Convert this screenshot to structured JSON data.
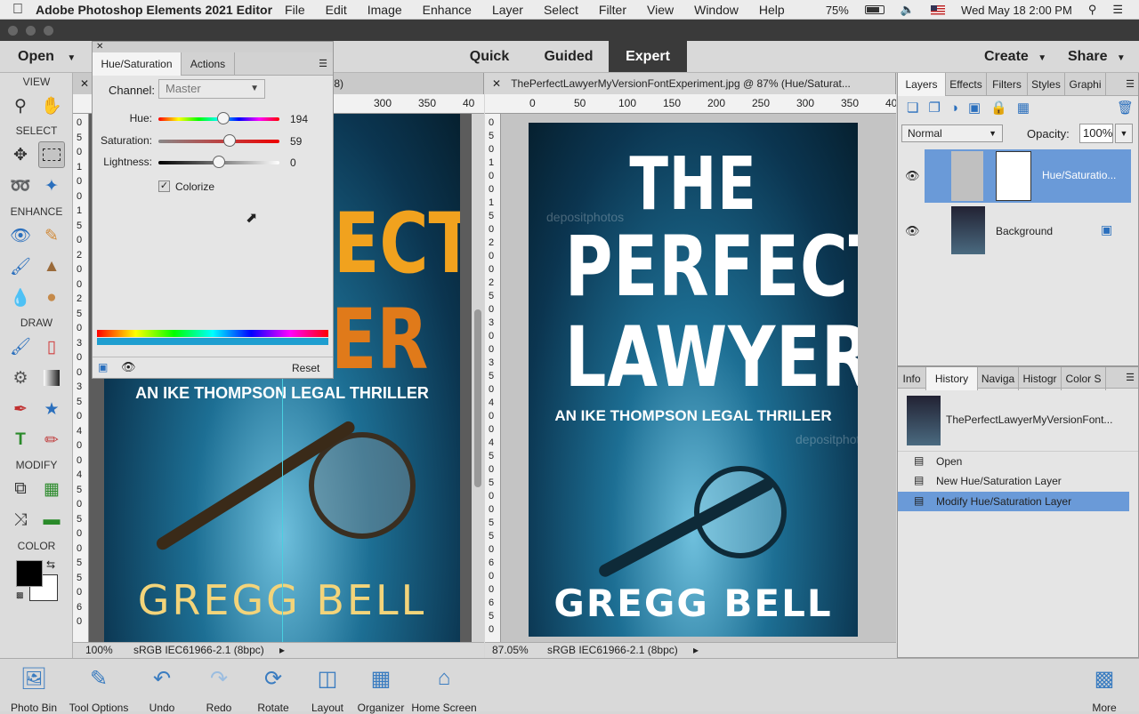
{
  "menubar": {
    "app_name": "Adobe Photoshop Elements 2021 Editor",
    "items": [
      "File",
      "Edit",
      "Image",
      "Enhance",
      "Layer",
      "Select",
      "Filter",
      "View",
      "Window",
      "Help"
    ],
    "battery": "75%",
    "datetime": "Wed May 18  2:00 PM"
  },
  "modebar": {
    "open": "Open",
    "modes": [
      "Quick",
      "Guided",
      "Expert"
    ],
    "active_mode": "Expert",
    "create": "Create",
    "share": "Share"
  },
  "toolbox": {
    "view": "VIEW",
    "select": "SELECT",
    "enhance": "ENHANCE",
    "draw": "DRAW",
    "modify": "MODIFY",
    "color": "COLOR",
    "fg_color": "#000000",
    "bg_color": "#ffffff"
  },
  "doc_left": {
    "tab_fragment": "/8)",
    "ruler_h": [
      "300",
      "350",
      "40"
    ],
    "ruler_v": [
      "0",
      "5",
      "0",
      "1",
      "0",
      "0",
      "1",
      "5",
      "0",
      "2",
      "0",
      "0",
      "2",
      "5",
      "0",
      "3",
      "0",
      "0",
      "3",
      "5",
      "0",
      "4",
      "0",
      "0",
      "4",
      "5",
      "0",
      "5",
      "0",
      "0",
      "5",
      "5",
      "0",
      "6",
      "0"
    ],
    "zoom": "100%",
    "profile": "sRGB IEC61966-2.1 (8bpc)",
    "cover": {
      "title_a": "ECT",
      "title_b": "ER",
      "subtitle": "AN IKE THOMPSON LEGAL THRILLER",
      "author": "GREGG BELL"
    }
  },
  "doc_right": {
    "tab_title": "ThePerfectLawyerMyVersionFontExperiment.jpg @ 87% (Hue/Saturat...",
    "ruler_h": [
      "0",
      "50",
      "100",
      "150",
      "200",
      "250",
      "300",
      "350",
      "40"
    ],
    "ruler_v": [
      "0",
      "5",
      "0",
      "1",
      "0",
      "0",
      "1",
      "5",
      "0",
      "2",
      "0",
      "0",
      "2",
      "5",
      "0",
      "3",
      "0",
      "0",
      "3",
      "5",
      "0",
      "4",
      "0",
      "0",
      "4",
      "5",
      "0",
      "5",
      "0",
      "0",
      "5",
      "5",
      "0",
      "6",
      "0",
      "0",
      "6",
      "5",
      "0"
    ],
    "zoom": "87.05%",
    "profile": "sRGB IEC61966-2.1 (8bpc)",
    "cover": {
      "line1": "THE",
      "line2": "PERFECT",
      "line3": "LAWYER",
      "subtitle": "AN IKE THOMPSON LEGAL THRILLER",
      "author": "GREGG BELL",
      "watermark": "depositphotos"
    }
  },
  "hue_panel": {
    "tabs": [
      "Hue/Saturation",
      "Actions"
    ],
    "channel_label": "Channel:",
    "channel_value": "Master",
    "hue_label": "Hue:",
    "hue_value": "194",
    "hue_level": 0.54,
    "saturation_label": "Saturation:",
    "saturation_value": "59",
    "saturation_level": 0.59,
    "lightness_label": "Lightness:",
    "lightness_value": "0",
    "lightness_level": 0.5,
    "colorize_label": "Colorize",
    "reset": "Reset"
  },
  "layers_panel": {
    "tabs": [
      "Layers",
      "Effects",
      "Filters",
      "Styles",
      "Graphi"
    ],
    "blend_mode": "Normal",
    "opacity_label": "Opacity:",
    "opacity_value": "100%",
    "layers": [
      {
        "name": "Hue/Saturatio..."
      },
      {
        "name": "Background"
      }
    ]
  },
  "history_panel": {
    "tabs": [
      "Info",
      "History",
      "Naviga",
      "Histogr",
      "Color S"
    ],
    "document": "ThePerfectLawyerMyVersionFont...",
    "items": [
      "Open",
      "New Hue/Saturation Layer",
      "Modify Hue/Saturation Layer"
    ]
  },
  "bottombar": {
    "buttons": [
      "Photo Bin",
      "Tool Options",
      "Undo",
      "Redo",
      "Rotate",
      "Layout",
      "Organizer",
      "Home Screen"
    ],
    "more": "More"
  }
}
